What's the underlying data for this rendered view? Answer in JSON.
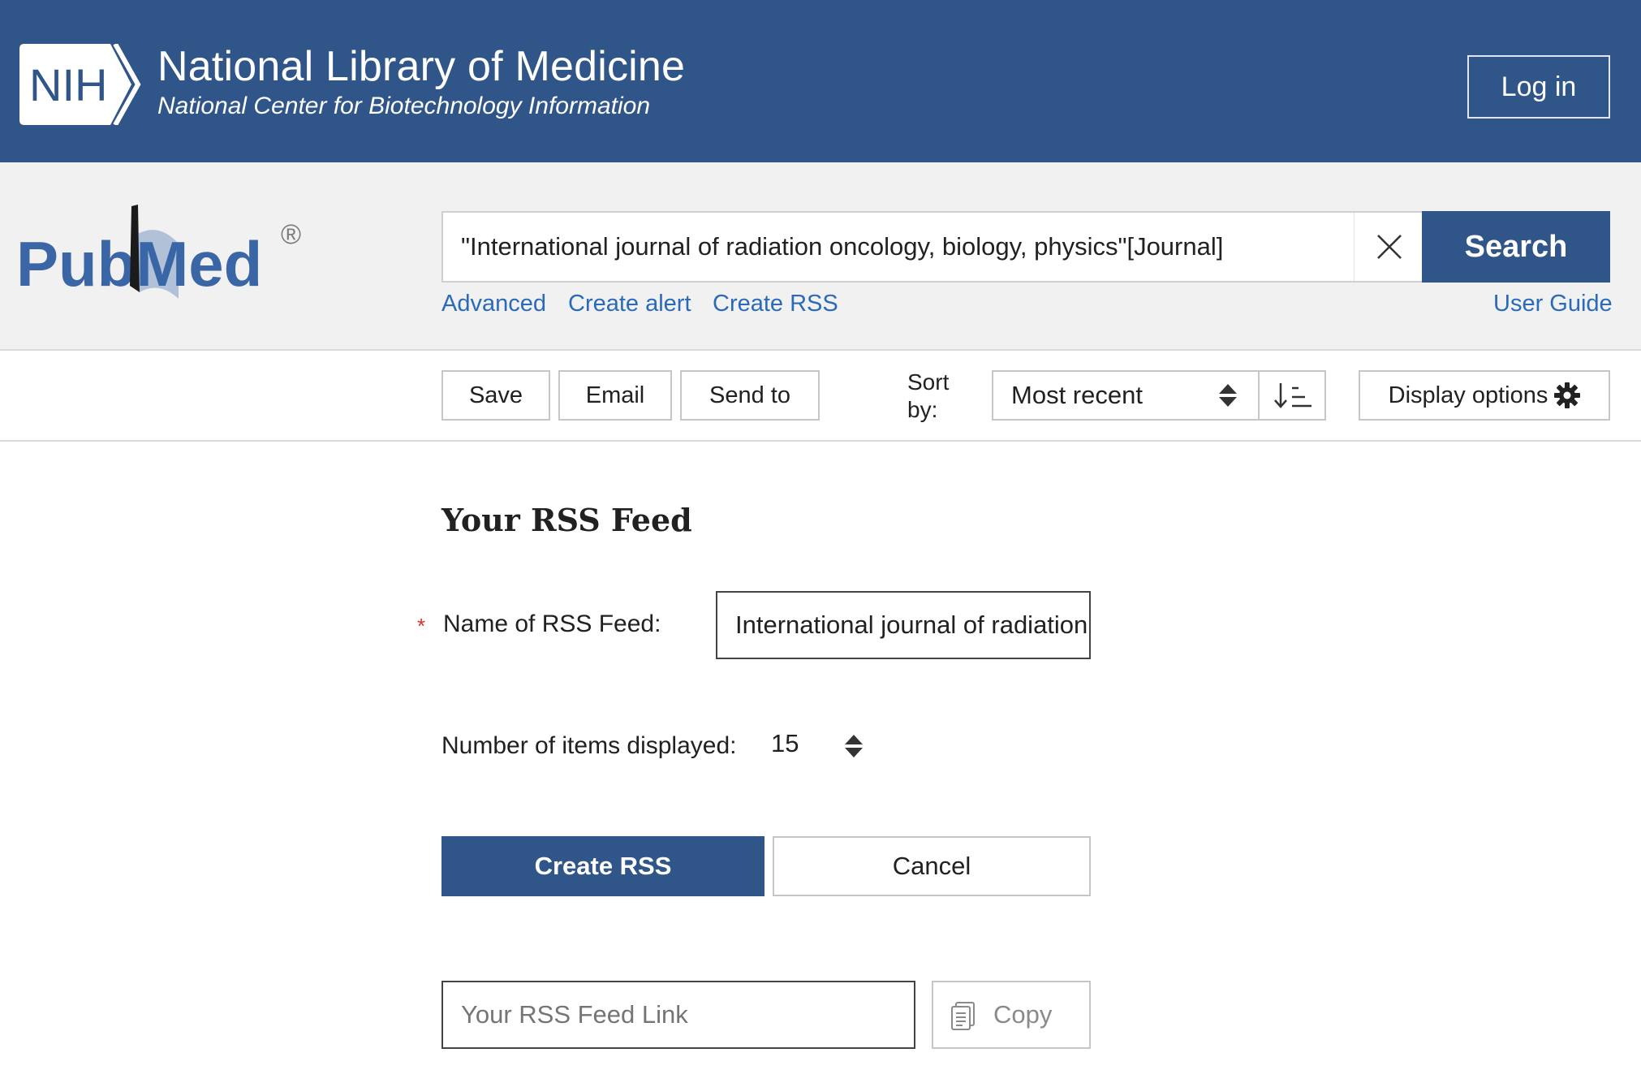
{
  "header": {
    "badge_text": "NIH",
    "title": "National Library of Medicine",
    "subtitle": "National Center for Biotechnology Information",
    "login_label": "Log in"
  },
  "search": {
    "logo_text": "PubMed",
    "logo_mark": "®",
    "query": "\"International journal of radiation oncology, biology, physics\"[Journal]",
    "button_label": "Search",
    "links": {
      "advanced": "Advanced",
      "create_alert": "Create alert",
      "create_rss": "Create RSS",
      "user_guide": "User Guide"
    }
  },
  "toolbar": {
    "save_label": "Save",
    "email_label": "Email",
    "send_to_label": "Send to",
    "sort_label_line1": "Sort",
    "sort_label_line2": "by:",
    "sort_value": "Most recent",
    "display_options_label": "Display options"
  },
  "rss_form": {
    "title": "Your RSS Feed",
    "required_mark": "*",
    "name_label": "Name of RSS Feed:",
    "name_value": "International journal of radiation oncology, biology, physics",
    "items_label": "Number of items displayed:",
    "items_value": "15",
    "create_label": "Create RSS",
    "cancel_label": "Cancel",
    "feed_link_placeholder": "Your RSS Feed Link",
    "copy_label": "Copy"
  },
  "colors": {
    "brand_blue": "#2f5589",
    "link_blue": "#2b6ab8",
    "required_red": "#d0342c"
  },
  "icons": [
    "nih-logo-icon",
    "pubmed-logo",
    "close-icon",
    "sort-caret-icon",
    "sort-order-icon",
    "gear-icon",
    "copy-icon"
  ]
}
